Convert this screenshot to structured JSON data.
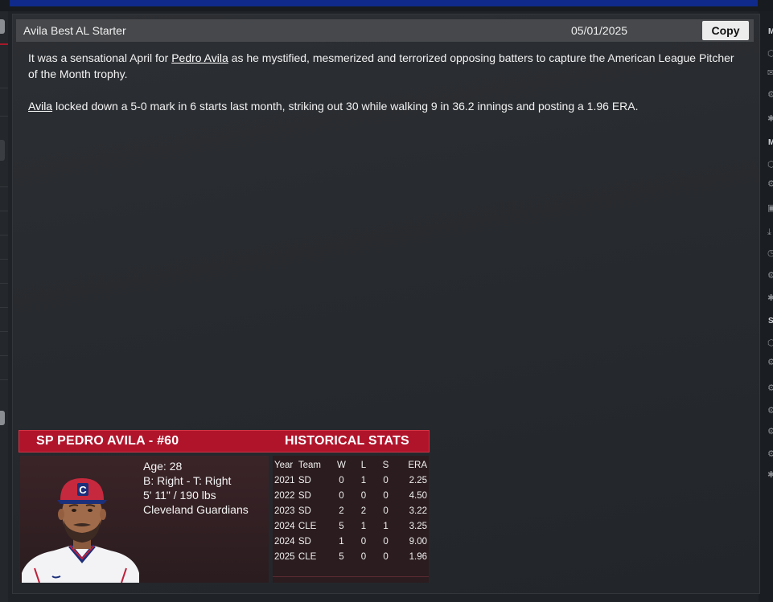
{
  "news": {
    "title": "Avila Best AL Starter",
    "date": "05/01/2025",
    "copy_label": "Copy",
    "p1": {
      "before": "It was a sensational April for ",
      "link": "Pedro Avila",
      "after": " as he mystified, mesmerized and terrorized opposing batters to capture the American League Pitcher of the Month trophy."
    },
    "p2": {
      "link": "Avila",
      "after": " locked down a 5-0 mark in 6 starts last month, striking out 30 while walking 9 in 36.2 innings and posting a 1.96 ERA."
    }
  },
  "player_card": {
    "header": "SP PEDRO AVILA - #60",
    "stats_header": "HISTORICAL STATS",
    "age": "Age: 28",
    "bats_throws": "B: Right - T: Right",
    "height_weight": "5' 11\" / 190 lbs",
    "team": "Cleveland Guardians",
    "cap_letter": "C"
  },
  "stats": {
    "columns": [
      "Year",
      "Team",
      "W",
      "L",
      "S",
      "ERA"
    ],
    "rows": [
      [
        "2021",
        "SD",
        "0",
        "1",
        "0",
        "2.25"
      ],
      [
        "2022",
        "SD",
        "0",
        "0",
        "0",
        "4.50"
      ],
      [
        "2023",
        "SD",
        "2",
        "2",
        "0",
        "3.22"
      ],
      [
        "2024",
        "CLE",
        "5",
        "1",
        "1",
        "3.25"
      ],
      [
        "2024",
        "SD",
        "1",
        "0",
        "0",
        "9.00"
      ],
      [
        "2025",
        "CLE",
        "5",
        "0",
        "0",
        "1.96"
      ]
    ]
  },
  "right_sidebar": {
    "letters": [
      "M",
      "M",
      "S"
    ],
    "icons": [
      "nav-icon",
      "mail-icon",
      "gear-icon",
      "puzzle-icon",
      "nav-icon",
      "gear-icon",
      "copy-icon",
      "download-icon",
      "clock-icon",
      "gear-icon",
      "puzzle-icon",
      "nav-icon",
      "gear-icon",
      "gear-icon",
      "gear-icon",
      "gear-icon",
      "gear-icon",
      "puzzle-icon"
    ]
  },
  "colors": {
    "accent_red": "#b0142b",
    "panel_bg": "#2a2d31",
    "header_bg": "#46484b",
    "top_blue": "#0f2a8a"
  }
}
